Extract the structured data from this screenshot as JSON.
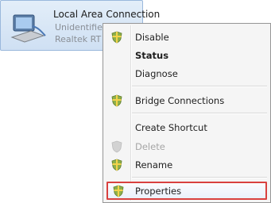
{
  "adapter": {
    "name": "Local Area Connection",
    "status": "Unidentifie",
    "device": "Realtek RT",
    "icon": "network-adapter-icon"
  },
  "menu": {
    "items": [
      {
        "label": "Disable",
        "icon": "shield-icon"
      },
      {
        "label": "Status"
      },
      {
        "label": "Diagnose"
      },
      {
        "label": "Bridge Connections",
        "icon": "shield-icon"
      },
      {
        "label": "Create Shortcut"
      },
      {
        "label": "Delete",
        "icon": "shield-icon",
        "disabled": true
      },
      {
        "label": "Rename",
        "icon": "shield-icon"
      },
      {
        "label": "Properties",
        "icon": "shield-icon",
        "highlighted": true
      }
    ]
  },
  "colors": {
    "highlight_border": "#d9413f",
    "tile_background": "#dbe8f6"
  }
}
